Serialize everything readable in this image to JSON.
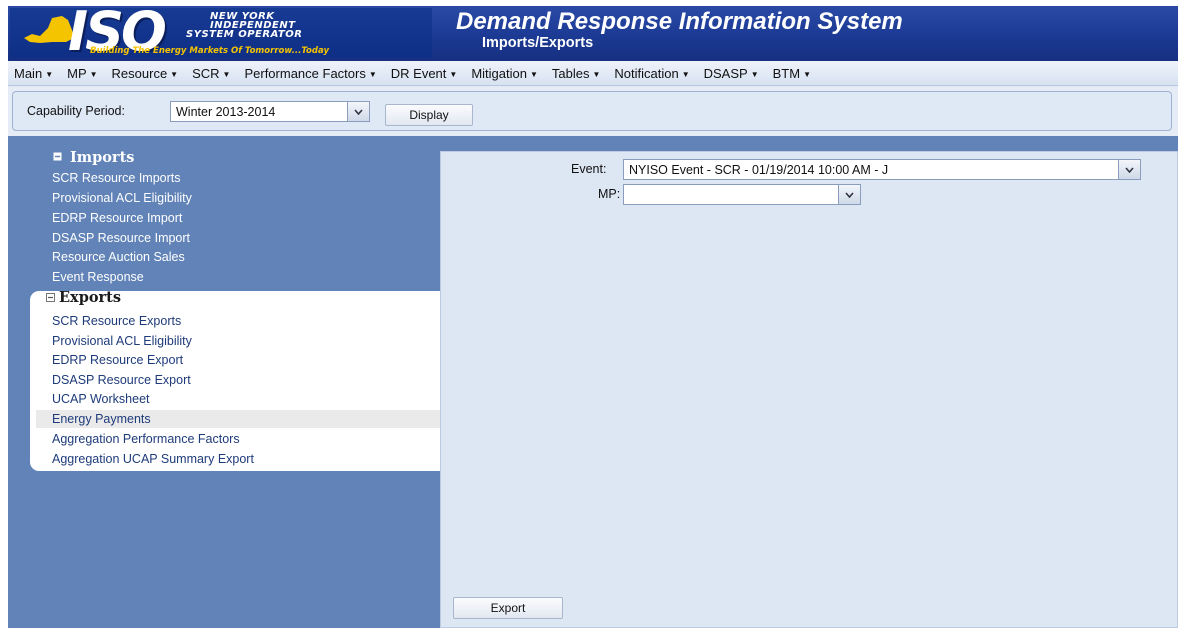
{
  "header": {
    "logo_text": "ISO",
    "logo_org_line1": "NEW YORK",
    "logo_org_line2": "INDEPENDENT",
    "logo_org_line3": "SYSTEM OPERATOR",
    "logo_tagline": "Building The Energy Markets Of Tomorrow...Today",
    "app_title": "Demand Response Information System",
    "page_subtitle": "Imports/Exports"
  },
  "menu": {
    "items": [
      "Main",
      "MP",
      "Resource",
      "SCR",
      "Performance Factors",
      "DR Event",
      "Mitigation",
      "Tables",
      "Notification",
      "DSASP",
      "BTM"
    ],
    "caret_icon": "caret-down-icon"
  },
  "toolbar": {
    "capability_label": "Capability Period:",
    "capability_value": "Winter 2013-2014",
    "display_label": "Display"
  },
  "sidebar": {
    "imports": {
      "title": "Imports",
      "items": [
        "SCR Resource Imports",
        "Provisional ACL Eligibility",
        "EDRP Resource Import",
        "DSASP Resource Import",
        "Resource Auction Sales",
        "Event Response"
      ]
    },
    "exports": {
      "title": "Exports",
      "items": [
        "SCR Resource Exports",
        "Provisional ACL Eligibility",
        "EDRP Resource Export",
        "DSASP Resource Export",
        "UCAP Worksheet",
        "Energy Payments",
        "Aggregation Performance Factors",
        "Aggregation UCAP Summary Export"
      ],
      "selected": "Energy Payments"
    }
  },
  "form": {
    "event_label": "Event:",
    "event_value": "NYISO Event - SCR - 01/19/2014 10:00 AM - J",
    "mp_label": "MP:",
    "mp_value": "",
    "export_label": "Export"
  },
  "colors": {
    "header_bg": "#1c3a94",
    "accent_yellow": "#f5c400",
    "sidebar_bg": "#6183b8",
    "content_bg": "#dde6f3"
  }
}
